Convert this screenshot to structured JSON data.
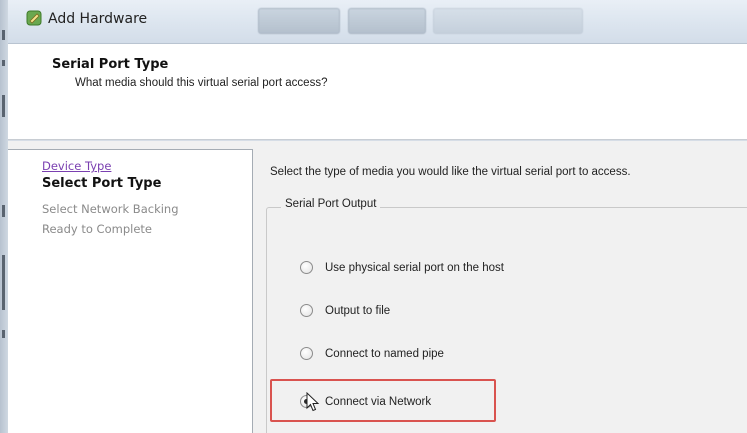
{
  "window": {
    "title": "Add Hardware",
    "icon": "add-hardware-icon"
  },
  "header": {
    "title": "Serial Port Type",
    "subtitle": "What media should this virtual serial port access?"
  },
  "nav": {
    "items": [
      {
        "label": "Device Type",
        "state": "link"
      },
      {
        "label": "Select Port Type",
        "state": "current"
      },
      {
        "label": "Select Network Backing",
        "state": "pending"
      },
      {
        "label": "Ready to Complete",
        "state": "pending"
      }
    ]
  },
  "main": {
    "instruction": "Select the type of media you would like the virtual serial port to access.",
    "group_label": "Serial Port Output",
    "options": [
      {
        "label": "Use physical serial port on the host",
        "checked": false
      },
      {
        "label": "Output to file",
        "checked": false
      },
      {
        "label": "Connect to named pipe",
        "checked": false
      },
      {
        "label": "Connect via Network",
        "checked": true
      }
    ]
  },
  "colors": {
    "highlight": "#d9534f",
    "visited_link": "#7a3fb0",
    "muted_text": "#8a8a8a"
  }
}
